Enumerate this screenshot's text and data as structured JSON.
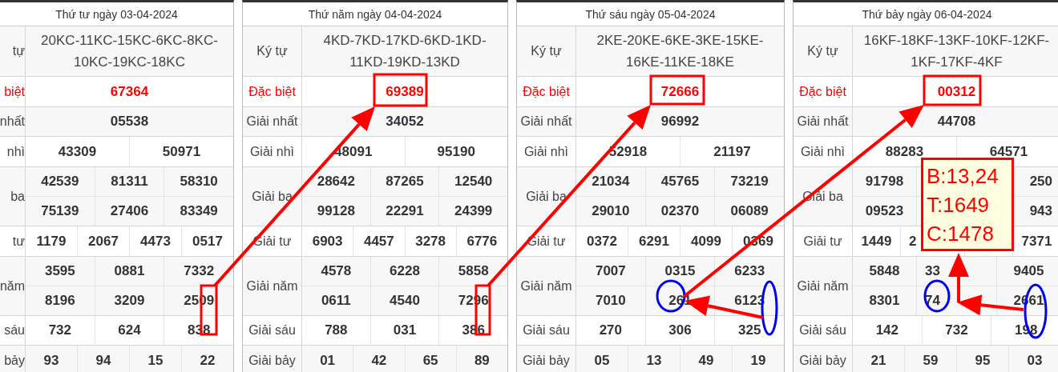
{
  "days": [
    {
      "title": "Thứ tư ngày 03-04-2024",
      "cropped": true,
      "rows": [
        {
          "kind": "code",
          "label": "tự",
          "lines": [
            "20KC-11KC-15KC-6KC-8KC-10KC-19KC-18KC"
          ]
        },
        {
          "kind": "prize",
          "special": true,
          "label": "biệt",
          "lines": [
            [
              "67364"
            ]
          ]
        },
        {
          "kind": "prize",
          "special": false,
          "label": "nhất",
          "lines": [
            [
              "05538"
            ]
          ]
        },
        {
          "kind": "prize",
          "special": false,
          "label": "nhì",
          "lines": [
            [
              "43309",
              "50971"
            ]
          ]
        },
        {
          "kind": "prize",
          "special": false,
          "label": "ba",
          "lines": [
            [
              "42539",
              "81311",
              "58310"
            ],
            [
              "75139",
              "27406",
              "83349"
            ]
          ]
        },
        {
          "kind": "prize",
          "special": false,
          "label": "tư",
          "lines": [
            [
              "1179",
              "2067",
              "4473",
              "0517"
            ]
          ]
        },
        {
          "kind": "prize",
          "special": false,
          "label": "năm",
          "lines": [
            [
              "3595",
              "0881",
              "7332"
            ],
            [
              "8196",
              "3209",
              "2509"
            ]
          ]
        },
        {
          "kind": "prize",
          "special": false,
          "label": "sáu",
          "lines": [
            [
              "732",
              "624",
              "838"
            ]
          ]
        },
        {
          "kind": "prize",
          "special": false,
          "label": "bảy",
          "lines": [
            [
              "93",
              "94",
              "15",
              "22"
            ]
          ]
        }
      ]
    },
    {
      "title": "Thứ năm ngày 04-04-2024",
      "cropped": false,
      "rows": [
        {
          "kind": "code",
          "label": "Ký tự",
          "lines": [
            "4KD-7KD-17KD-6KD-1KD-11KD-19KD-13KD"
          ]
        },
        {
          "kind": "prize",
          "special": true,
          "label": "Đặc biệt",
          "lines": [
            [
              "69389"
            ]
          ]
        },
        {
          "kind": "prize",
          "special": false,
          "label": "Giải nhất",
          "lines": [
            [
              "34052"
            ]
          ]
        },
        {
          "kind": "prize",
          "special": false,
          "label": "Giải nhì",
          "lines": [
            [
              "48091",
              "95190"
            ]
          ]
        },
        {
          "kind": "prize",
          "special": false,
          "label": "Giải ba",
          "lines": [
            [
              "28642",
              "87265",
              "12540"
            ],
            [
              "99128",
              "22291",
              "24399"
            ]
          ]
        },
        {
          "kind": "prize",
          "special": false,
          "label": "Giải tư",
          "lines": [
            [
              "6903",
              "4457",
              "3278",
              "6776"
            ]
          ]
        },
        {
          "kind": "prize",
          "special": false,
          "label": "Giải năm",
          "lines": [
            [
              "4578",
              "6228",
              "5858"
            ],
            [
              "0611",
              "4540",
              "7296"
            ]
          ]
        },
        {
          "kind": "prize",
          "special": false,
          "label": "Giải sáu",
          "lines": [
            [
              "788",
              "031",
              "386"
            ]
          ]
        },
        {
          "kind": "prize",
          "special": false,
          "label": "Giải bảy",
          "lines": [
            [
              "01",
              "42",
              "65",
              "89"
            ]
          ]
        }
      ]
    },
    {
      "title": "Thứ sáu ngày 05-04-2024",
      "cropped": false,
      "rows": [
        {
          "kind": "code",
          "label": "Ký tự",
          "lines": [
            "2KE-20KE-6KE-3KE-15KE-16KE-11KE-18KE"
          ]
        },
        {
          "kind": "prize",
          "special": true,
          "label": "Đặc biệt",
          "lines": [
            [
              "72666"
            ]
          ]
        },
        {
          "kind": "prize",
          "special": false,
          "label": "Giải nhất",
          "lines": [
            [
              "96992"
            ]
          ]
        },
        {
          "kind": "prize",
          "special": false,
          "label": "Giải nhì",
          "lines": [
            [
              "52918",
              "21197"
            ]
          ]
        },
        {
          "kind": "prize",
          "special": false,
          "label": "Giải ba",
          "lines": [
            [
              "21034",
              "45765",
              "73219"
            ],
            [
              "29010",
              "02370",
              "06089"
            ]
          ]
        },
        {
          "kind": "prize",
          "special": false,
          "label": "Giải tư",
          "lines": [
            [
              "0372",
              "6291",
              "4099",
              "0369"
            ]
          ]
        },
        {
          "kind": "prize",
          "special": false,
          "label": "Giải năm",
          "lines": [
            [
              "7007",
              "0315",
              "6233"
            ],
            [
              "7010",
              "261",
              "6123"
            ]
          ]
        },
        {
          "kind": "prize",
          "special": false,
          "label": "Giải sáu",
          "lines": [
            [
              "270",
              "306",
              "325"
            ]
          ]
        },
        {
          "kind": "prize",
          "special": false,
          "label": "Giải bảy",
          "lines": [
            [
              "05",
              "13",
              "49",
              "19"
            ]
          ]
        }
      ]
    },
    {
      "title": "Thứ bảy ngày 06-04-2024",
      "cropped": false,
      "rows": [
        {
          "kind": "code",
          "label": "Ký tự",
          "lines": [
            "16KF-18KF-13KF-10KF-12KF-1KF-17KF-4KF"
          ]
        },
        {
          "kind": "prize",
          "special": true,
          "label": "Đặc biệt",
          "lines": [
            [
              "00312"
            ]
          ]
        },
        {
          "kind": "prize",
          "special": false,
          "label": "Giải nhất",
          "lines": [
            [
              "44708"
            ]
          ]
        },
        {
          "kind": "prize",
          "special": false,
          "label": "Giải nhì",
          "lines": [
            [
              "88283",
              "64571"
            ]
          ]
        },
        {
          "kind": "prize",
          "special": false,
          "label": "Giải ba",
          "lines": [
            [
              "91798",
              {
                "covered": true
              },
              {
                "text": "250",
                "partly_covered": true
              }
            ],
            [
              "09523",
              {
                "covered": true
              },
              {
                "text": "943",
                "partly_covered": true
              }
            ]
          ]
        },
        {
          "kind": "prize",
          "special": false,
          "label": "Giải tư",
          "lines": [
            [
              "1449",
              {
                "text": "2",
                "partly_covered": true
              },
              {
                "covered": true
              },
              "7371"
            ]
          ]
        },
        {
          "kind": "prize",
          "special": false,
          "label": "Giải năm",
          "lines": [
            [
              "5848",
              {
                "text": "33",
                "partly_covered": true
              },
              "9405"
            ],
            [
              "8301",
              {
                "text": "74",
                "partly_covered": true
              },
              "2661"
            ]
          ]
        },
        {
          "kind": "prize",
          "special": false,
          "label": "Giải sáu",
          "lines": [
            [
              "142",
              "732",
              "198"
            ]
          ]
        },
        {
          "kind": "prize",
          "special": false,
          "label": "Giải bảy",
          "lines": [
            [
              "21",
              "59",
              "95",
              "03"
            ]
          ]
        }
      ]
    }
  ],
  "callout": [
    "B:13,24",
    "T:1649",
    "C:1478"
  ]
}
